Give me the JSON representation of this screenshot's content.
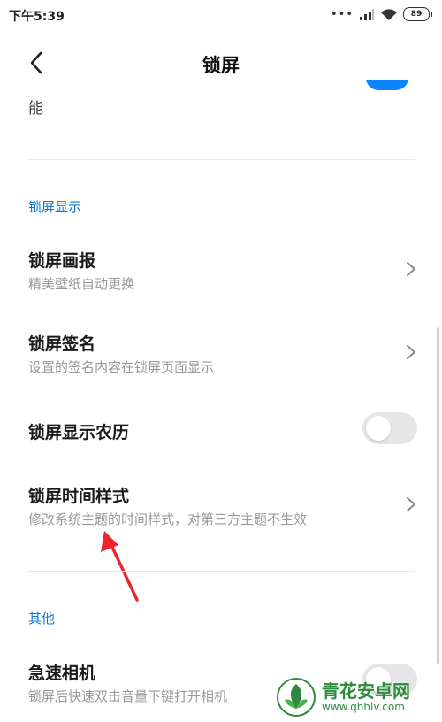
{
  "status_bar": {
    "time": "下午5:39",
    "battery": "89"
  },
  "header": {
    "title": "锁屏"
  },
  "partial": {
    "text": "能"
  },
  "sections": [
    {
      "header": "锁屏显示"
    },
    {
      "header": "其他"
    }
  ],
  "items": [
    {
      "title": "锁屏画报",
      "subtitle": "精美壁纸自动更换"
    },
    {
      "title": "锁屏签名",
      "subtitle": "设置的签名内容在锁屏页面显示"
    },
    {
      "title": "锁屏显示农历",
      "toggle_on": false
    },
    {
      "title": "锁屏时间样式",
      "subtitle": "修改系统主题的时间样式，对第三方主题不生效"
    },
    {
      "title": "急速相机",
      "subtitle": "锁屏后快速双击音量下键打开相机",
      "toggle_on": false
    }
  ],
  "watermark": {
    "name": "青花安卓网",
    "url": "www.qhhlv.com"
  },
  "colors": {
    "accent": "#0d84ff",
    "section_header": "#0c78d6",
    "annotation_arrow": "#e8262c",
    "watermark": "#2e8b3d"
  }
}
